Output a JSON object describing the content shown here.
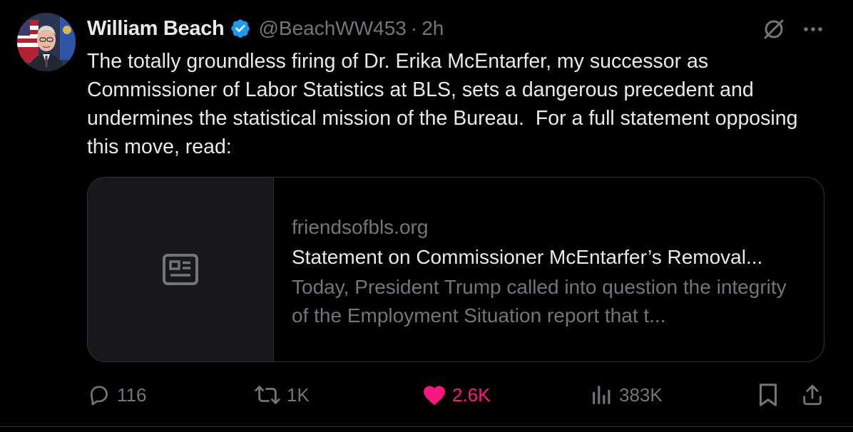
{
  "tweet": {
    "author_name": "William Beach",
    "handle": "@BeachWW453",
    "separator": "·",
    "time": "2h",
    "text": "The totally groundless firing of Dr. Erika McEntarfer, my successor as Commissioner of Labor Statistics at BLS, sets a dangerous precedent and undermines the statistical mission of the Bureau.  For a full statement opposing this move, read:",
    "icons": {
      "verified": "verified-badge-icon",
      "grok": "grok-icon",
      "more": "more-options-icon"
    }
  },
  "link_card": {
    "domain": "friendsofbls.org",
    "title": "Statement on Commissioner McEntarfer’s Removal...",
    "description": "Today, President Trump called into question the integrity of the Employment Situation report that t...",
    "thumbnail_icon": "article-icon"
  },
  "actions": {
    "replies": "116",
    "reposts": "1K",
    "likes": "2.6K",
    "views": "383K"
  },
  "colors": {
    "background": "#000000",
    "text_primary": "#e7e9ea",
    "text_secondary": "#71767b",
    "border": "#2f3336",
    "verified_blue": "#1d9bf0",
    "like_pink": "#f91880"
  }
}
